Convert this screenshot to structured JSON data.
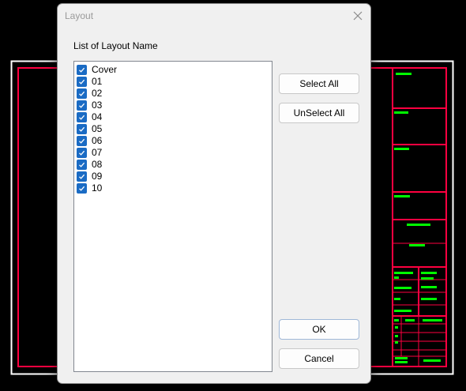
{
  "dialog": {
    "title": "Layout",
    "close_icon": "close-icon",
    "list_label": "List of Layout Name",
    "items": [
      {
        "label": "Cover",
        "checked": true
      },
      {
        "label": "01",
        "checked": true
      },
      {
        "label": "02",
        "checked": true
      },
      {
        "label": "03",
        "checked": true
      },
      {
        "label": "04",
        "checked": true
      },
      {
        "label": "05",
        "checked": true
      },
      {
        "label": "06",
        "checked": true
      },
      {
        "label": "07",
        "checked": true
      },
      {
        "label": "08",
        "checked": true
      },
      {
        "label": "09",
        "checked": true
      },
      {
        "label": "10",
        "checked": true
      }
    ],
    "buttons": {
      "select_all": "Select All",
      "unselect_all": "UnSelect All",
      "ok": "OK",
      "cancel": "Cancel"
    }
  },
  "colors": {
    "cad_background": "#000000",
    "cad_border": "#ffffff",
    "cad_frame": "#ff0040",
    "cad_text": "#00ff00",
    "checkbox": "#1a6bc4"
  }
}
